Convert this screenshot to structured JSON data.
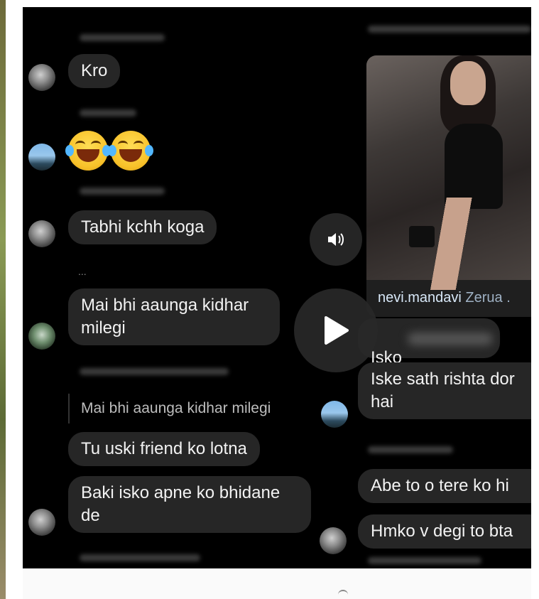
{
  "left_thread": {
    "messages": [
      {
        "type": "text",
        "text": "Kro",
        "avatar": "gray"
      },
      {
        "type": "emoji",
        "emojis": [
          "😂",
          "😂"
        ],
        "avatar": "blue"
      },
      {
        "type": "text",
        "text": "Tabhi kchh koga",
        "avatar": "gray"
      },
      {
        "type": "ellipsis",
        "text": "..."
      },
      {
        "type": "text",
        "text": "Mai bhi aaunga kidhar\nmilegi",
        "avatar": "green"
      },
      {
        "type": "reply_quote",
        "text": "Mai bhi aaunga kidhar milegi"
      },
      {
        "type": "text",
        "text": "Tu uski friend ko lotna"
      },
      {
        "type": "text",
        "text": "Baki isko apne ko bhidane\nde",
        "avatar": "gray"
      }
    ]
  },
  "right_thread": {
    "story": {
      "username": "nevi.mandavi",
      "name_fragment": "Zerua ."
    },
    "messages": [
      {
        "type": "text",
        "text": "Isko"
      },
      {
        "type": "text",
        "text": "Iske sath rishta dor\nhai",
        "avatar": "blue"
      },
      {
        "type": "text",
        "text": "Abe to o tere ko hi"
      },
      {
        "type": "text",
        "text": "Hmko v degi to bta",
        "avatar": "gray"
      }
    ]
  },
  "controls": {
    "volume_icon": "volume-icon",
    "play_icon": "play-icon"
  },
  "colors": {
    "background": "#000000",
    "bubble": "#262626",
    "text": "#f2f2f2",
    "caption_link": "#d8e8f8"
  }
}
